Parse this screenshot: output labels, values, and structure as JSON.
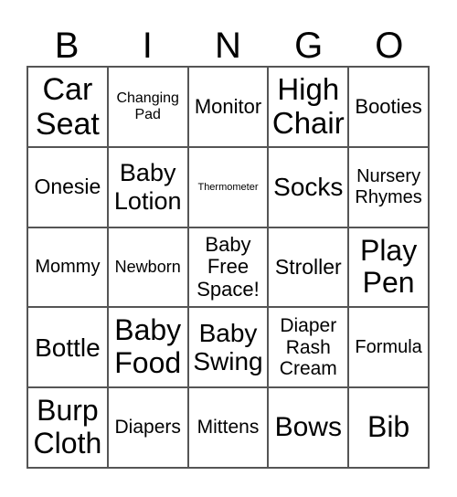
{
  "header": [
    "B",
    "I",
    "N",
    "G",
    "O"
  ],
  "cells": [
    "Car Seat",
    "Changing Pad",
    "Monitor",
    "High Chair",
    "Booties",
    "Onesie",
    "Baby Lotion",
    "Thermometer",
    "Socks",
    "Nursery Rhymes",
    "Mommy",
    "Newborn",
    "Baby Free Space!",
    "Stroller",
    "Play Pen",
    "Bottle",
    "Baby Food",
    "Baby Swing",
    "Diaper Rash Cream",
    "Formula",
    "Burp Cloth",
    "Diapers",
    "Mittens",
    "Bows",
    "Bib"
  ]
}
